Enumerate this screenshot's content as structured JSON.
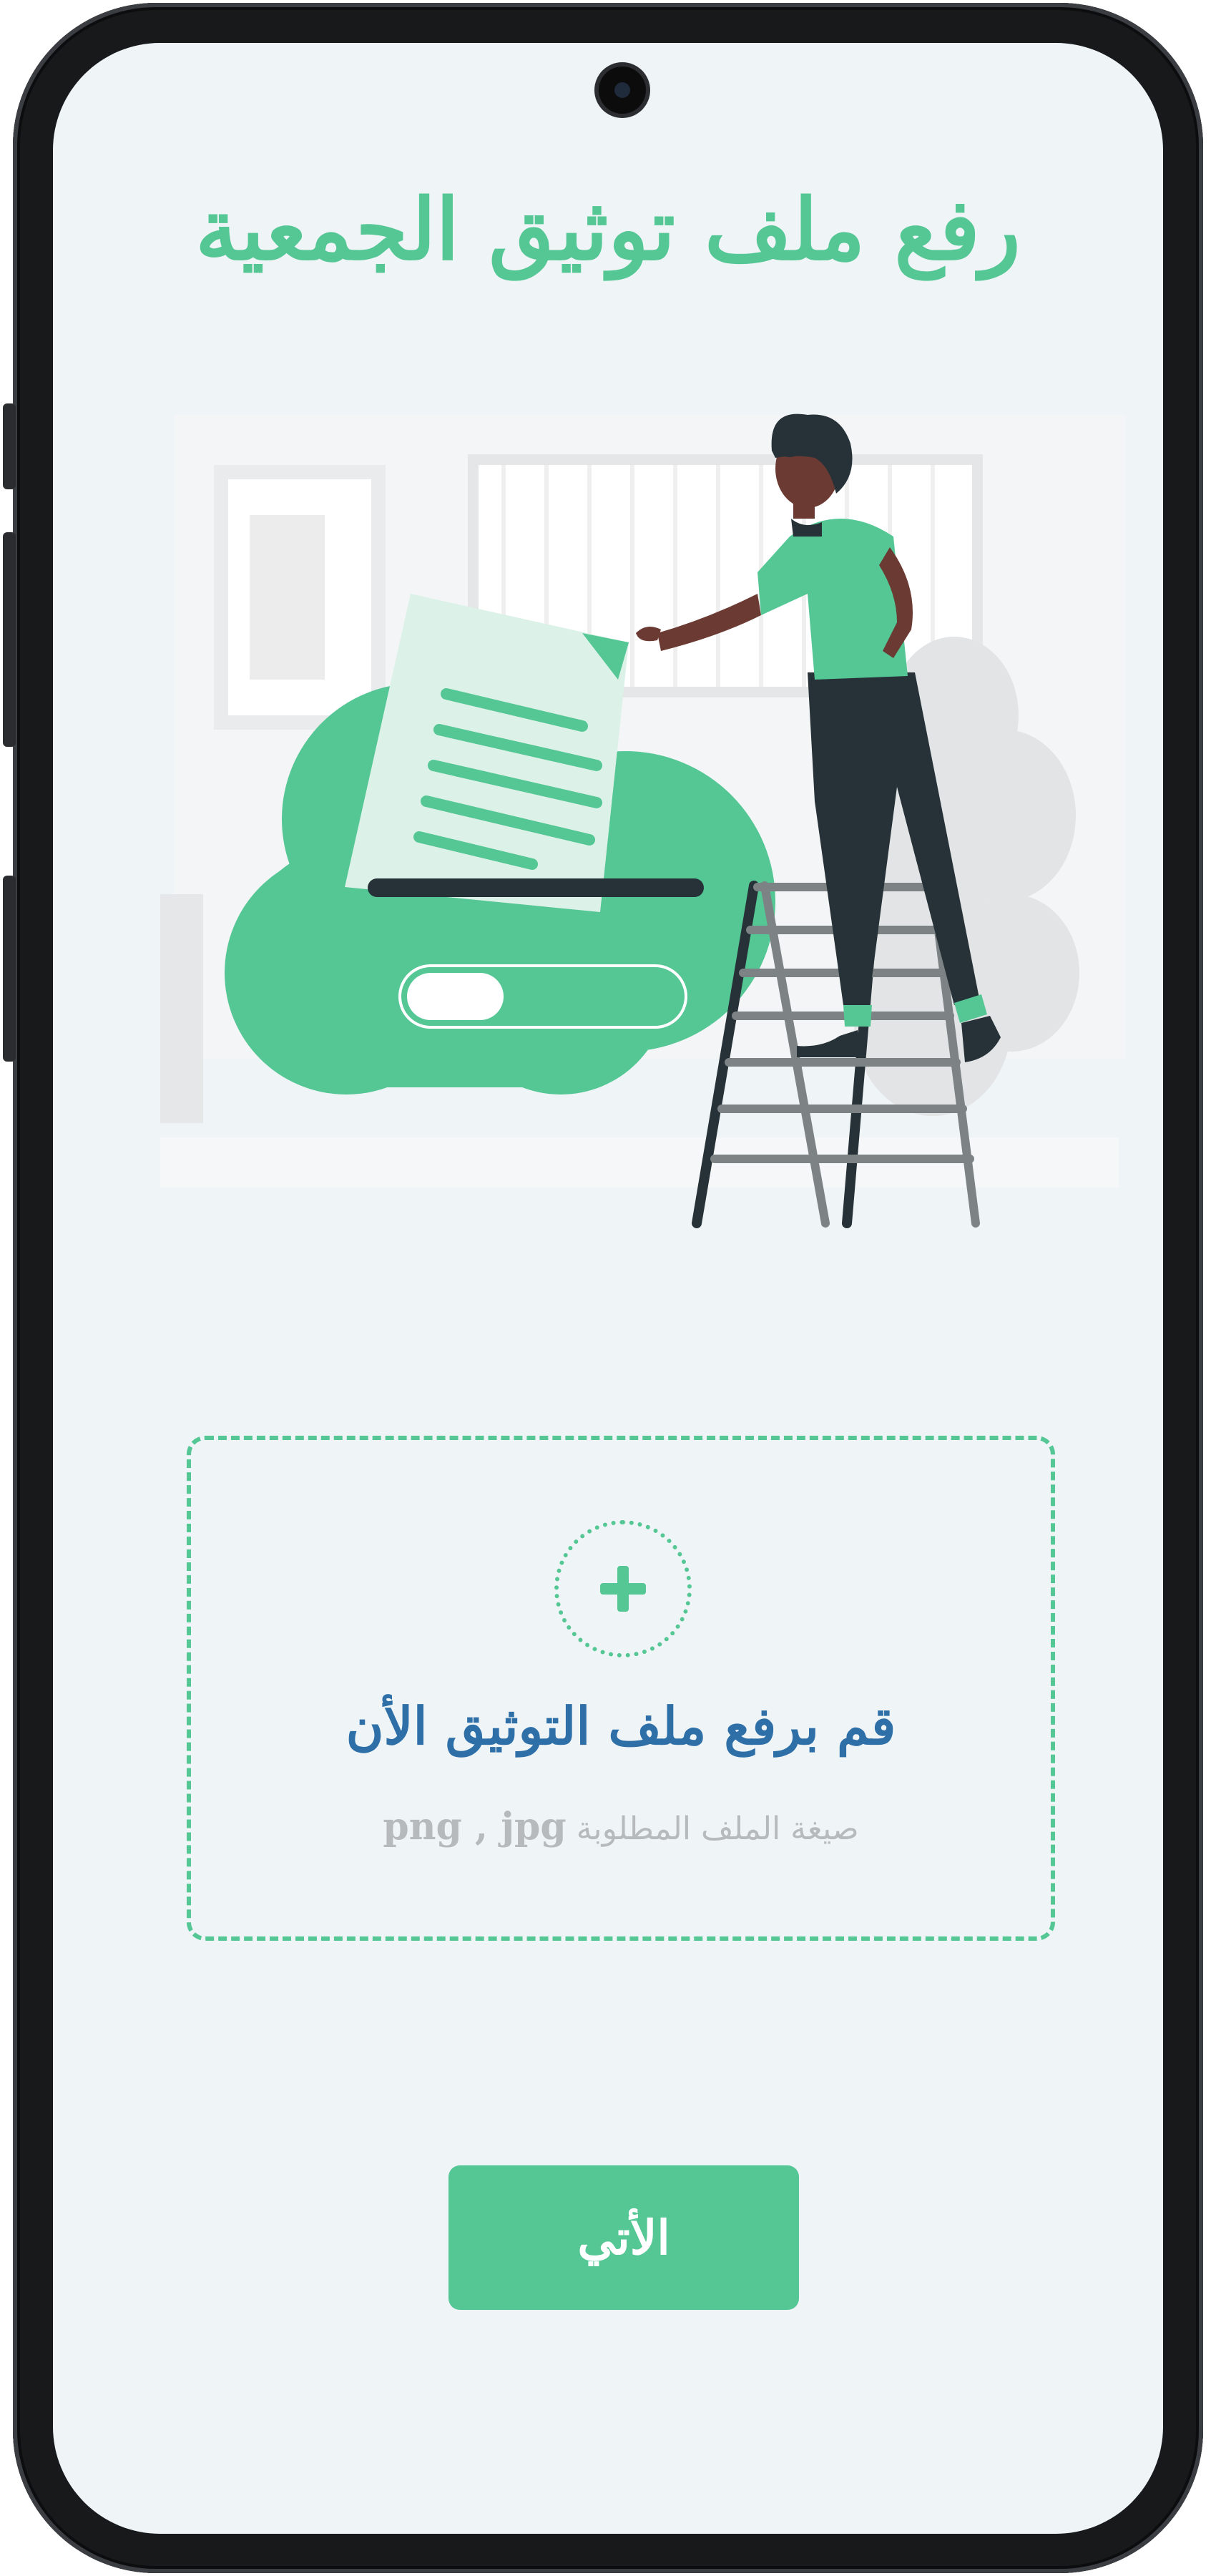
{
  "header": {
    "title": "رفع ملف توثيق الجمعية"
  },
  "illustration": {
    "icon": "file-upload-cloud-illustration"
  },
  "upload": {
    "title": "قم برفع ملف التوثيق الأن",
    "hint_label": "صيغة الملف المطلوبة",
    "hint_formats": "png , jpg",
    "icon": "plus-icon"
  },
  "actions": {
    "next_label": "الأتي"
  },
  "colors": {
    "accent": "#55c795",
    "upload_title": "#2e6fa8",
    "hint": "#b6babd",
    "background": "#eff4f7",
    "dark": "#263238"
  }
}
